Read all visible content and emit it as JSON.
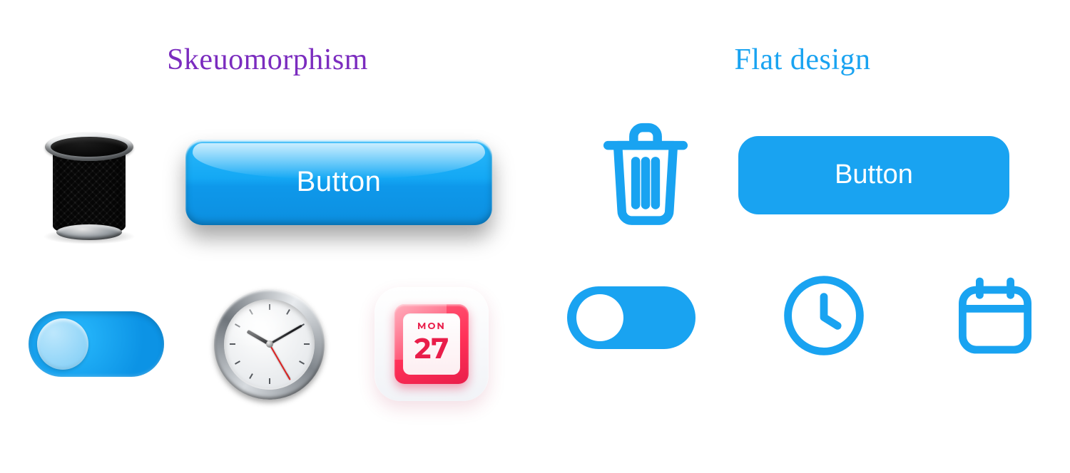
{
  "skeu": {
    "heading": "Skeuomorphism",
    "button_label": "Button",
    "calendar": {
      "day_of_week": "MON",
      "day_number": "27"
    },
    "toggle_state": "off"
  },
  "flat": {
    "heading": "Flat design",
    "button_label": "Button",
    "toggle_state": "off"
  },
  "colors": {
    "accent_blue": "#19A3F1",
    "heading_purple": "#7B2CBF",
    "calendar_red": "#E91E4A"
  }
}
